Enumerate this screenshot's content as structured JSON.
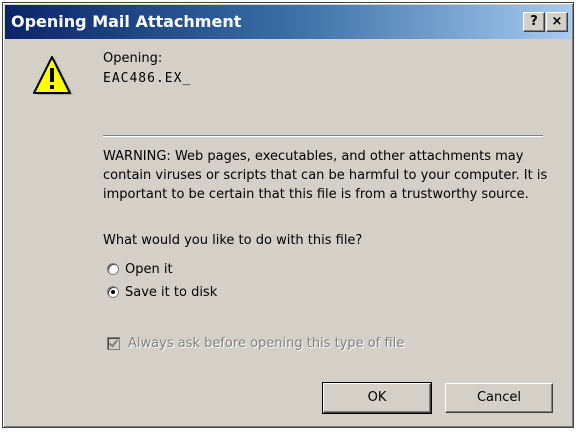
{
  "window": {
    "title": "Opening Mail Attachment",
    "help_label": "?",
    "close_label": "×"
  },
  "icon": "warning-icon",
  "opening": {
    "label": "Opening:",
    "filename": "EAC486.EX_"
  },
  "warning": {
    "text": "WARNING: Web pages, executables, and other attachments may contain viruses or scripts that can be harmful to your computer. It is important to be certain that this file is from a trustworthy source."
  },
  "question": "What would you like to do with this file?",
  "options": [
    {
      "label": "Open it",
      "selected": false
    },
    {
      "label": "Save it to disk",
      "selected": true
    }
  ],
  "always_ask": {
    "label": "Always ask before opening this type of file",
    "checked": true,
    "disabled": true
  },
  "buttons": {
    "ok": "OK",
    "cancel": "Cancel"
  },
  "colors": {
    "dialog_face": "#d4d0c8",
    "titlebar_start": "#0a246a",
    "titlebar_end": "#a6caf0",
    "warning_yellow": "#ffff00",
    "disabled_text": "#808080"
  }
}
